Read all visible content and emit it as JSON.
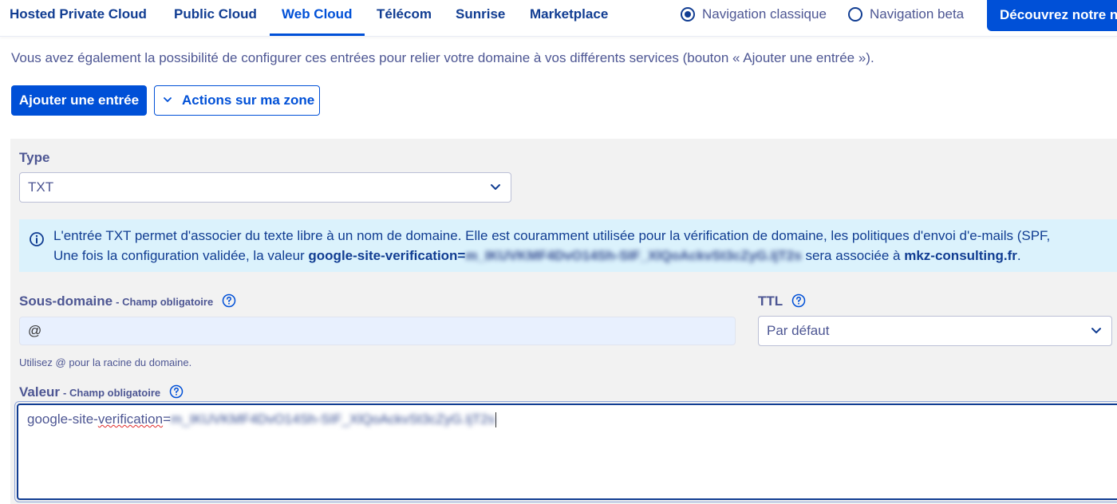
{
  "nav": {
    "items": [
      {
        "label": "Hosted Private Cloud"
      },
      {
        "label": "Public Cloud"
      },
      {
        "label": "Web Cloud",
        "active": true
      },
      {
        "label": "Télécom"
      },
      {
        "label": "Sunrise"
      },
      {
        "label": "Marketplace"
      }
    ],
    "radio_classic": "Navigation classique",
    "radio_beta": "Navigation beta",
    "discover_button": "Découvrez notre n"
  },
  "intro_text": "Vous avez également la possibilité de configurer ces entrées pour relier votre domaine à vos différents services (bouton « Ajouter une entrée »).",
  "actions": {
    "add_entry": "Ajouter une entrée",
    "zone_actions": "Actions sur ma zone"
  },
  "form": {
    "type_label": "Type",
    "type_value": "TXT",
    "info_line1": "L'entrée TXT permet d'associer du texte libre à un nom de domaine. Elle est couramment utilisée pour la vérification de domaine, les politiques d'envoi d'e-mails (SPF,",
    "info_line2_prefix": "Une fois la configuration validée, la valeur ",
    "info_value_key": "google-site-verification=",
    "info_value_redacted": "m_IKUVKMF4DvO14Sh-SIF_XlQoAckvSt3cZyG.IjT2s",
    "info_line2_mid": " sera associée à ",
    "info_domain": "mkz-consulting.fr",
    "info_line2_end": ".",
    "subdomain_label": "Sous-domaine",
    "required_tag": "- Champ obligatoire",
    "subdomain_value": "@",
    "subdomain_hint": "Utilisez @ pour la racine du domaine.",
    "ttl_label": "TTL",
    "ttl_value": "Par défaut",
    "value_label": "Valeur",
    "value_prefix": "google-site-",
    "value_misspelled": "verification",
    "value_eq": "=",
    "value_redacted": "m_IKUVKMF4DvO14Sh-SIF_XlQoAckvSt3cZyG.IjT2s"
  },
  "colors": {
    "primary": "#0050d7",
    "navy": "#113d92",
    "info_bg": "#dbf2fc",
    "panel_bg": "#f2f2f2"
  }
}
